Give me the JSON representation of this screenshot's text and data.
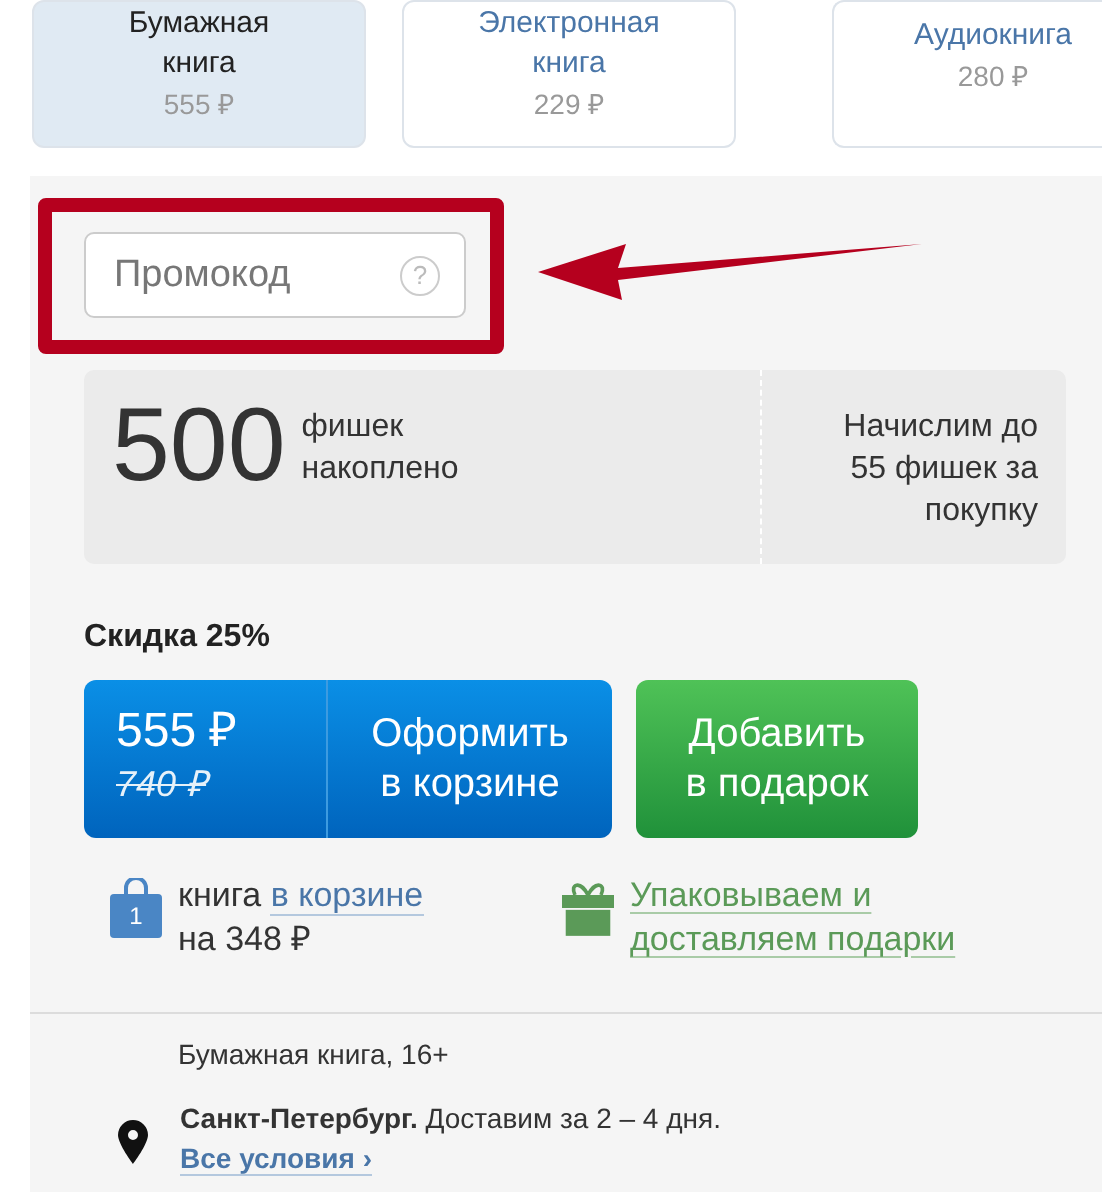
{
  "formats": [
    {
      "label": "Бумажная книга",
      "price": "555 ₽",
      "selected": true
    },
    {
      "label": "Электронная книга",
      "price": "229 ₽",
      "selected": false
    },
    {
      "label": "Аудиокнига",
      "price": "280 ₽",
      "selected": false
    }
  ],
  "promo": {
    "placeholder": "Промокод",
    "help": "?"
  },
  "points": {
    "count": "500",
    "caption": "фишек накоплено",
    "bonus": "Начислим до 55 фишек за покупку"
  },
  "discount": "Скидка 25%",
  "buy": {
    "price": "555 ₽",
    "old_price": "740 ₽",
    "label": "Оформить в корзине"
  },
  "gift_button": "Добавить в подарок",
  "cart_info": {
    "count": "1",
    "text": "книга",
    "link": "в корзине",
    "sum": "на 348 ₽"
  },
  "gift_link": "Упаковываем и доставляем подарки",
  "book_type": "Бумажная книга, 16+",
  "delivery": {
    "city": "Санкт-Петербург.",
    "text": "Доставим за 2 – 4 дня.",
    "link": "Все условия ›"
  }
}
